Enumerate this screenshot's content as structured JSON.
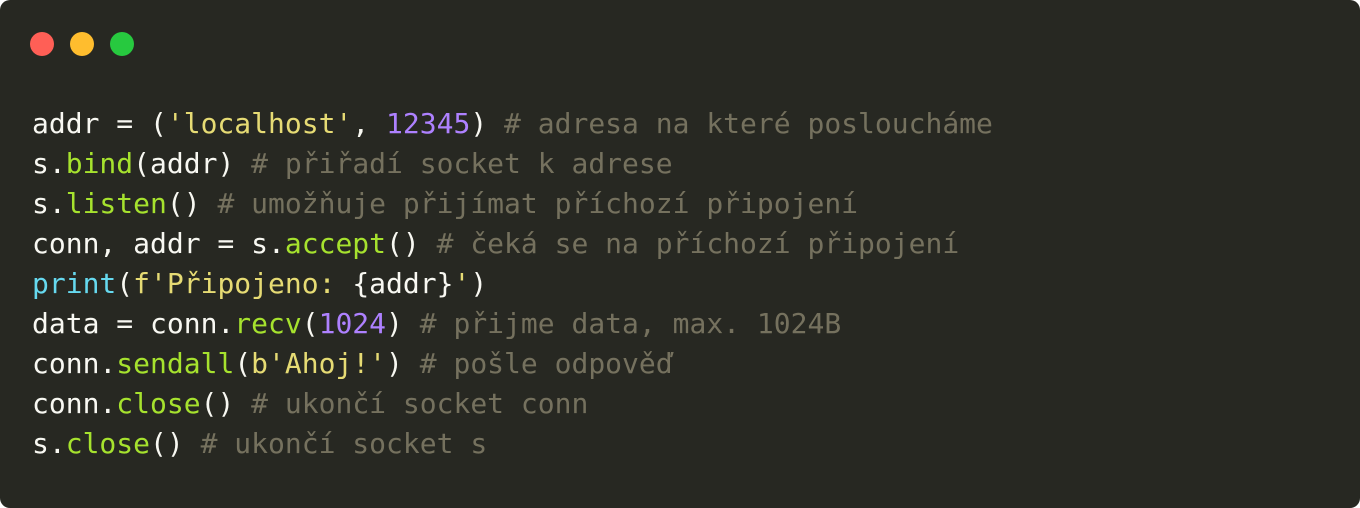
{
  "window": {
    "controls": [
      {
        "name": "close",
        "color": "#ff5f56"
      },
      {
        "name": "minimize",
        "color": "#ffbd2e"
      },
      {
        "name": "zoom",
        "color": "#27c93f"
      }
    ]
  },
  "colors": {
    "background": "#272822",
    "plain": "#f8f8f2",
    "string": "#e6db74",
    "number": "#ae81ff",
    "func": "#a6e22e",
    "builtin": "#66d9ef",
    "comment": "#75715e"
  },
  "code": {
    "lines": [
      [
        [
          "plain",
          "addr = ("
        ],
        [
          "string",
          "'localhost'"
        ],
        [
          "plain",
          ", "
        ],
        [
          "number",
          "12345"
        ],
        [
          "plain",
          ") "
        ],
        [
          "comment",
          "# adresa na které posloucháme"
        ]
      ],
      [
        [
          "plain",
          "s."
        ],
        [
          "func",
          "bind"
        ],
        [
          "plain",
          "(addr) "
        ],
        [
          "comment",
          "# přiřadí socket k adrese"
        ]
      ],
      [
        [
          "plain",
          "s."
        ],
        [
          "func",
          "listen"
        ],
        [
          "plain",
          "() "
        ],
        [
          "comment",
          "# umožňuje přijímat příchozí připojení"
        ]
      ],
      [
        [
          "plain",
          "conn, addr = s."
        ],
        [
          "func",
          "accept"
        ],
        [
          "plain",
          "() "
        ],
        [
          "comment",
          "# čeká se na příchozí připojení"
        ]
      ],
      [
        [
          "builtin",
          "print"
        ],
        [
          "plain",
          "("
        ],
        [
          "string",
          "f'Připojeno: "
        ],
        [
          "plain",
          "{addr}"
        ],
        [
          "string",
          "'"
        ],
        [
          "plain",
          ")"
        ]
      ],
      [
        [
          "plain",
          "data = conn."
        ],
        [
          "func",
          "recv"
        ],
        [
          "plain",
          "("
        ],
        [
          "number",
          "1024"
        ],
        [
          "plain",
          ") "
        ],
        [
          "comment",
          "# přijme data, max. 1024B"
        ]
      ],
      [
        [
          "plain",
          "conn."
        ],
        [
          "func",
          "sendall"
        ],
        [
          "plain",
          "("
        ],
        [
          "string",
          "b'Ahoj!'"
        ],
        [
          "plain",
          ") "
        ],
        [
          "comment",
          "# pošle odpověď"
        ]
      ],
      [
        [
          "plain",
          "conn."
        ],
        [
          "func",
          "close"
        ],
        [
          "plain",
          "() "
        ],
        [
          "comment",
          "# ukončí socket conn"
        ]
      ],
      [
        [
          "plain",
          "s."
        ],
        [
          "func",
          "close"
        ],
        [
          "plain",
          "() "
        ],
        [
          "comment",
          "# ukončí socket s"
        ]
      ]
    ]
  }
}
